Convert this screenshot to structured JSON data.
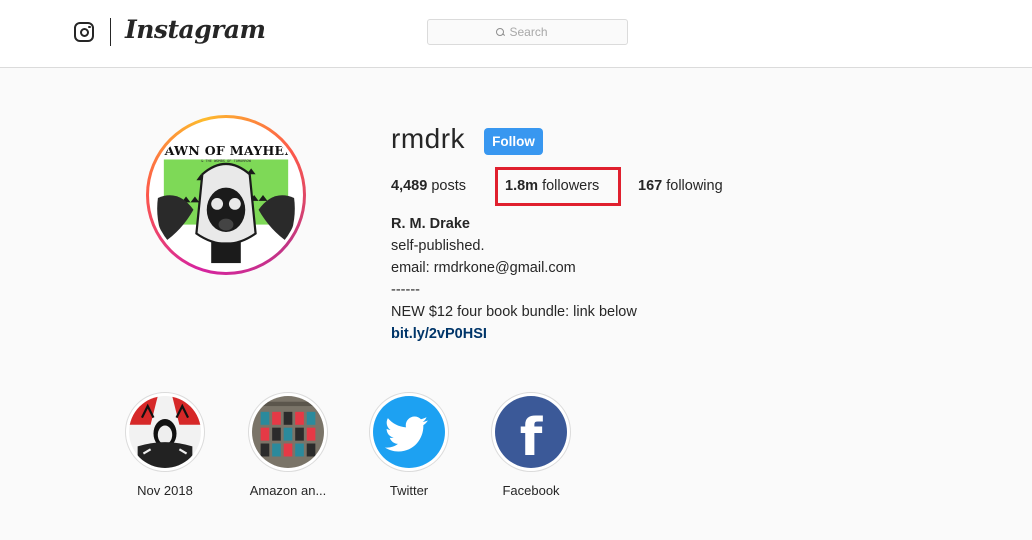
{
  "header": {
    "brand": "Instagram",
    "icons": {
      "logo": "instagram-glyph-icon",
      "search": "search-icon"
    },
    "search": {
      "placeholder": "Search",
      "value": ""
    }
  },
  "profile": {
    "username": "rmdrk",
    "follow_label": "Follow",
    "avatar_text": {
      "title": "DAWN OF MAYHEM",
      "subtitle": "& THE WOMBS OF TOMORROW"
    },
    "stats": {
      "posts": {
        "count": "4,489",
        "label": "posts"
      },
      "followers": {
        "count": "1.8m",
        "label": "followers"
      },
      "following": {
        "count": "167",
        "label": "following"
      }
    },
    "bio": {
      "full_name": "R. M. Drake",
      "lines": [
        "self-published.",
        "email: rmdrkone@gmail.com",
        "------",
        "NEW $12 four book bundle: link below"
      ],
      "link": "bit.ly/2vP0HSI"
    }
  },
  "highlights": [
    {
      "label": "Nov 2018",
      "icon": "highlight-nov-2018-image"
    },
    {
      "label": "Amazon an...",
      "icon": "highlight-amazon-image"
    },
    {
      "label": "Twitter",
      "icon": "twitter-bird-icon"
    },
    {
      "label": "Facebook",
      "icon": "facebook-f-icon"
    }
  ],
  "colors": {
    "accent": "#3897f0",
    "link": "#003569",
    "highlight_box": "#e0202e",
    "twitter": "#1da1f2",
    "facebook": "#3b5998",
    "avatar_green": "#7ed957"
  }
}
